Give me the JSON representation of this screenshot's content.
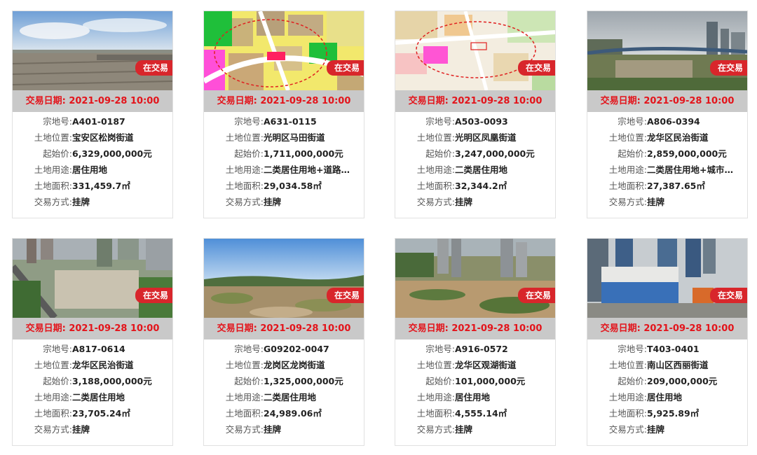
{
  "labels": {
    "date": "交易日期:",
    "parcel": "宗地号:",
    "location": "土地位置:",
    "start_price": "起始价:",
    "usage": "土地用途:",
    "area": "土地面积:",
    "method": "交易方式:"
  },
  "badge": "在交易",
  "colors": {
    "accent_red": "#d8262b",
    "date_red": "#e3141b",
    "date_bar": "#c9c9c9"
  },
  "cards": [
    {
      "date": "2021-09-28 10:00",
      "parcel": "A401-0187",
      "location": "宝安区松岗街道",
      "start_price": "6,329,000,000元",
      "usage": "居住用地",
      "area": "331,459.7㎡",
      "method": "挂牌",
      "image": "aerial-parking-lot-photo"
    },
    {
      "date": "2021-09-28 10:00",
      "parcel": "A631-0115",
      "location": "光明区马田街道",
      "start_price": "1,711,000,000元",
      "usage": "二类居住用地+道路…",
      "area": "29,034.58㎡",
      "method": "挂牌",
      "image": "zoning-map"
    },
    {
      "date": "2021-09-28 10:00",
      "parcel": "A503-0093",
      "location": "光明区凤凰街道",
      "start_price": "3,247,000,000元",
      "usage": "二类居住用地",
      "area": "32,344.2㎡",
      "method": "挂牌",
      "image": "zoning-map-light"
    },
    {
      "date": "2021-09-28 10:00",
      "parcel": "A806-0394",
      "location": "龙华区民治街道",
      "start_price": "2,859,000,000元",
      "usage": "二类居住用地+城市…",
      "area": "27,387.65㎡",
      "method": "挂牌",
      "image": "construction-site-photo"
    },
    {
      "date": "2021-09-28 10:00",
      "parcel": "A817-0614",
      "location": "龙华区民治街道",
      "start_price": "3,188,000,000元",
      "usage": "二类居住用地",
      "area": "23,705.24㎡",
      "method": "挂牌",
      "image": "aerial-city-lot-photo"
    },
    {
      "date": "2021-09-28 10:00",
      "parcel": "G09202-0047",
      "location": "龙岗区龙岗街道",
      "start_price": "1,325,000,000元",
      "usage": "二类居住用地",
      "area": "24,989.06㎡",
      "method": "挂牌",
      "image": "vacant-land-photo"
    },
    {
      "date": "2021-09-28 10:00",
      "parcel": "A916-0572",
      "location": "龙华区观湖街道",
      "start_price": "101,000,000元",
      "usage": "居住用地",
      "area": "4,555.14㎡",
      "method": "挂牌",
      "image": "hillside-lot-photo"
    },
    {
      "date": "2021-09-28 10:00",
      "parcel": "T403-0401",
      "location": "南山区西丽街道",
      "start_price": "209,000,000元",
      "usage": "居住用地",
      "area": "5,925.89㎡",
      "method": "挂牌",
      "image": "site-office-photo"
    }
  ]
}
